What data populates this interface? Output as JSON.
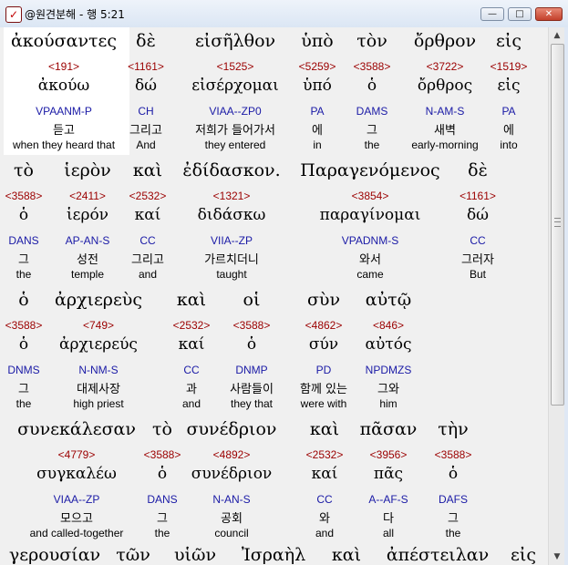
{
  "window": {
    "title": "@원견분해 - 행 5:21"
  },
  "title_buttons": {
    "minimize": "—",
    "maximize": "□",
    "close": "✕"
  },
  "scrollbar": {
    "up": "▲",
    "down": "▼"
  },
  "rows": [
    {
      "words": [
        {
          "gk": "ἀκούσαντες",
          "st": "<191>",
          "lx": "ἀκούω",
          "ps": "VPAANM-P",
          "ko": "듣고",
          "en": "when they heard that"
        },
        {
          "gk": "δὲ",
          "st": "<1161>",
          "lx": "δώ",
          "ps": "CH",
          "ko": "그리고",
          "en": "And"
        },
        {
          "gk": "εἰσῆλθον",
          "st": "<1525>",
          "lx": "εἰσέρχομαι",
          "ps": "VIAA--ZP0",
          "ko": "저희가 들어가서",
          "en": "they entered"
        },
        {
          "gk": "ὑπὸ",
          "st": "<5259>",
          "lx": "ὑπό",
          "ps": "PA",
          "ko": "에",
          "en": "in"
        },
        {
          "gk": "τὸν",
          "st": "<3588>",
          "lx": "ὁ",
          "ps": "DAMS",
          "ko": "그",
          "en": "the"
        },
        {
          "gk": "ὄρθρον",
          "st": "<3722>",
          "lx": "ὄρθρος",
          "ps": "N-AM-S",
          "ko": "새벽",
          "en": "early-morning"
        },
        {
          "gk": "εἰς",
          "st": "<1519>",
          "lx": "εἰς",
          "ps": "PA",
          "ko": "에",
          "en": "into"
        }
      ]
    },
    {
      "words": [
        {
          "gk": "τὸ",
          "st": "<3588>",
          "lx": "ὁ",
          "ps": "DANS",
          "ko": "그",
          "en": "the"
        },
        {
          "gk": "ἱερὸν",
          "st": "<2411>",
          "lx": "ἱερόν",
          "ps": "AP-AN-S",
          "ko": "성전",
          "en": "temple"
        },
        {
          "gk": "καὶ",
          "st": "<2532>",
          "lx": "καί",
          "ps": "CC",
          "ko": "그리고",
          "en": "and"
        },
        {
          "gk": "ἐδίδασκον.",
          "st": "<1321>",
          "lx": "διδάσκω",
          "ps": "VIIA--ZP",
          "ko": "가르치더니",
          "en": "taught"
        },
        {
          "gk": "Παραγενόμενος",
          "st": "<3854>",
          "lx": "παραγίνομαι",
          "ps": "VPADNM-S",
          "ko": "와서",
          "en": "came"
        },
        {
          "gk": "δὲ",
          "st": "<1161>",
          "lx": "δώ",
          "ps": "CC",
          "ko": "그러자",
          "en": "But"
        }
      ]
    },
    {
      "words": [
        {
          "gk": "ὁ",
          "st": "<3588>",
          "lx": "ὁ",
          "ps": "DNMS",
          "ko": "그",
          "en": "the"
        },
        {
          "gk": "ἀρχιερεὺς",
          "st": "<749>",
          "lx": "ἀρχιερεύς",
          "ps": "N-NM-S",
          "ko": "대제사장",
          "en": "high priest"
        },
        {
          "gk": "καὶ",
          "st": "<2532>",
          "lx": "καί",
          "ps": "CC",
          "ko": "과",
          "en": "and"
        },
        {
          "gk": "οἱ",
          "st": "<3588>",
          "lx": "ὁ",
          "ps": "DNMP",
          "ko": "사람들이",
          "en": "they that"
        },
        {
          "gk": "σὺν",
          "st": "<4862>",
          "lx": "σύν",
          "ps": "PD",
          "ko": "함께 있는",
          "en": "were with"
        },
        {
          "gk": "αὐτῷ",
          "st": "<846>",
          "lx": "αὐτός",
          "ps": "NPDMZS",
          "ko": "그와",
          "en": "him"
        }
      ]
    },
    {
      "words": [
        {
          "gk": "συνεκάλεσαν",
          "st": "<4779>",
          "lx": "συγκαλέω",
          "ps": "VIAA--ZP",
          "ko": "모으고",
          "en": "and called-together"
        },
        {
          "gk": "τὸ",
          "st": "<3588>",
          "lx": "ὁ",
          "ps": "DANS",
          "ko": "그",
          "en": "the"
        },
        {
          "gk": "συνέδριον",
          "st": "<4892>",
          "lx": "συνέδριον",
          "ps": "N-AN-S",
          "ko": "공회",
          "en": "council"
        },
        {
          "gk": "καὶ",
          "st": "<2532>",
          "lx": "καί",
          "ps": "CC",
          "ko": "와",
          "en": "and"
        },
        {
          "gk": "πᾶσαν",
          "st": "<3956>",
          "lx": "πᾶς",
          "ps": "A--AF-S",
          "ko": "다",
          "en": "all"
        },
        {
          "gk": "τὴν",
          "st": "<3588>",
          "lx": "ὁ",
          "ps": "DAFS",
          "ko": "그",
          "en": "the"
        }
      ]
    },
    {
      "words": [
        {
          "gk": "γερουσίαν"
        },
        {
          "gk": "τῶν"
        },
        {
          "gk": "υἱῶν"
        },
        {
          "gk": "Ἰσραὴλ"
        },
        {
          "gk": "καὶ"
        },
        {
          "gk": "ἀπέστειλαν"
        },
        {
          "gk": "εἰς"
        }
      ]
    }
  ]
}
